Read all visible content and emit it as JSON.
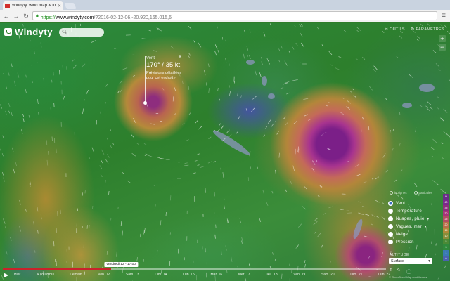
{
  "browser": {
    "tab_title": "Windyty, wind map & fore",
    "url_scheme": "https://",
    "url_host": "www.windyty.com",
    "url_path": "/?2016-02-12-06,-20.920,165.015,6"
  },
  "app": {
    "logo_text": "Windyty",
    "menu": {
      "tools_label": "OUTILS",
      "settings_label": "PARAMETRES"
    },
    "zoom": {
      "in_label": "+",
      "out_label": "−"
    }
  },
  "popup": {
    "label": "Vent",
    "value": "170° / 35 kt",
    "link": "Prévisions détaillées pour cet endroit ›",
    "close_label": "×"
  },
  "layers": {
    "overlay_options": [
      "isolignes",
      "particules"
    ],
    "items": [
      {
        "label": "Vent",
        "selected": true,
        "has_menu": false
      },
      {
        "label": "Température",
        "selected": false,
        "has_menu": false
      },
      {
        "label": "Nuages, pluie",
        "selected": false,
        "has_menu": true
      },
      {
        "label": "Vagues, mer",
        "selected": false,
        "has_menu": true
      },
      {
        "label": "Neige",
        "selected": false,
        "has_menu": false
      },
      {
        "label": "Pression",
        "selected": false,
        "has_menu": false
      }
    ],
    "altitude_label": "ALTITUDE",
    "altitude_value": "Surface",
    "attribution": "© OpenStreetMap contributors"
  },
  "scale": {
    "steps": [
      "kt",
      "40",
      "35",
      "30",
      "25",
      "20",
      "15",
      "10",
      "5",
      "3",
      "1",
      "0"
    ],
    "colors": [
      "#6a2d8a",
      "#7b2a8c",
      "#8e2d7e",
      "#a6337a",
      "#b24d63",
      "#b96e4a",
      "#b08a3a",
      "#8a8e3a",
      "#4b8a36",
      "#2f8a3c",
      "#3a7ab2",
      "#4a62b0"
    ]
  },
  "timeline": {
    "current_label": "Vendredi 12 - 17:00",
    "progress": 0.282,
    "days": [
      "Hier",
      "Aujourd'hui",
      "Demain",
      "Ven. 12",
      "Sam. 13",
      "Dim. 14",
      "Lun. 15",
      "Mar. 16",
      "Mer. 17",
      "Jeu. 18",
      "Ven. 19",
      "Sam. 20",
      "Dim. 21",
      "Lun. 22"
    ]
  }
}
